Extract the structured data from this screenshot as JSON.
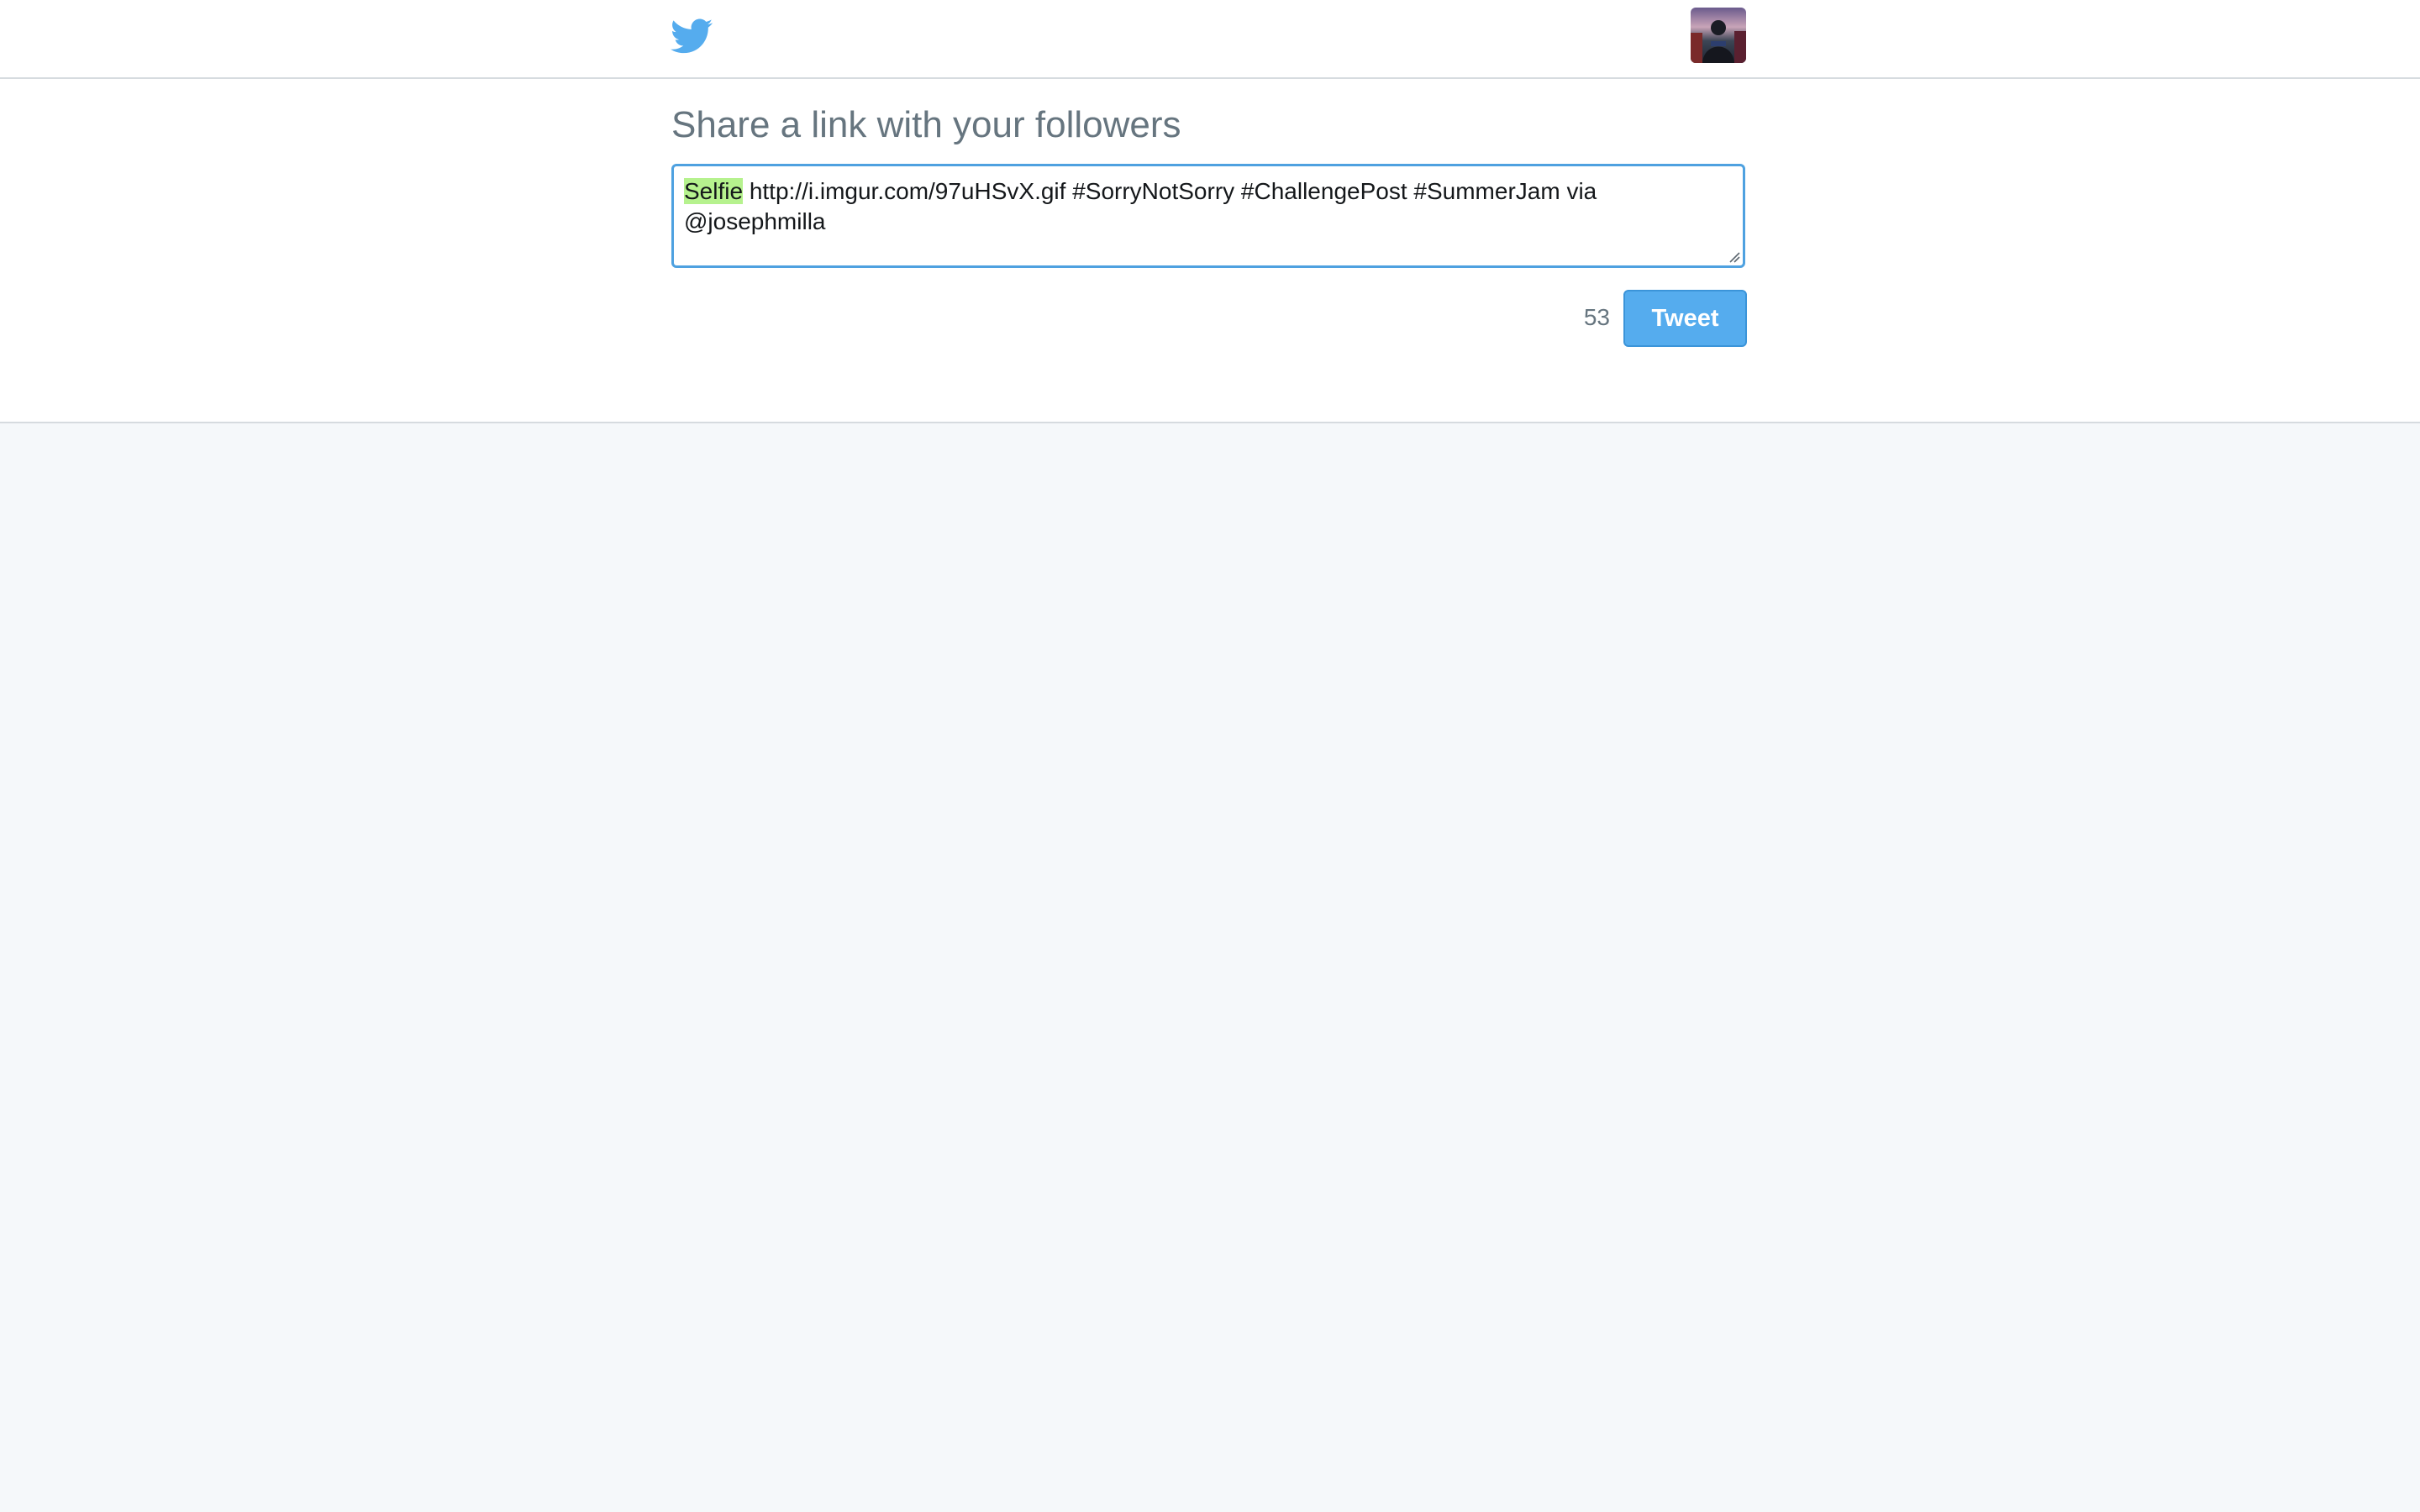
{
  "header": {
    "logo_icon": "twitter-bird-icon",
    "avatar_icon": "user-avatar"
  },
  "compose": {
    "title": "Share a link with your followers",
    "tweet_text_highlight": "Selfie",
    "tweet_text_rest": " http://i.imgur.com/97uHSvX.gif #SorryNotSorry #ChallengePost #SummerJam via @josephmilla",
    "char_count": "53",
    "tweet_button_label": "Tweet"
  },
  "colors": {
    "brand_blue": "#55acee",
    "focus_border": "#4ea1e0",
    "highlight": "#b6f28e",
    "muted_text": "#66757f",
    "page_background": "#f5f8fa"
  }
}
